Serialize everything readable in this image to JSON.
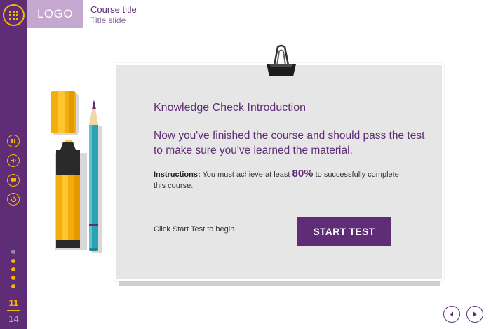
{
  "header": {
    "logo": "LOGO",
    "course_title": "Course title",
    "slide_title": "Title slide"
  },
  "sidebar": {
    "menu_icon": "grid-menu-icon",
    "controls": [
      "pause-icon",
      "volume-icon",
      "notes-icon",
      "replay-icon"
    ],
    "progress_dots": 6,
    "page_current": "11",
    "page_total": "14"
  },
  "content": {
    "title": "Knowledge Check Introduction",
    "main_text": "Now you've finished the course and should pass the test to make sure you've learned the material.",
    "instructions_label": "Instructions:",
    "instructions_before": " You must achieve at least ",
    "instructions_pct": "80%",
    "instructions_after": " to successfully complete this course.",
    "begin_text": "Click Start Test to begin.",
    "start_button": "START TEST"
  },
  "nav": {
    "prev_icon": "chevron-left-icon",
    "next_icon": "chevron-right-icon"
  },
  "colors": {
    "brand_purple": "#5e2d75",
    "accent_yellow": "#f5b800",
    "logo_bg": "#c5a8d0",
    "card_bg": "#e6e6e6"
  }
}
